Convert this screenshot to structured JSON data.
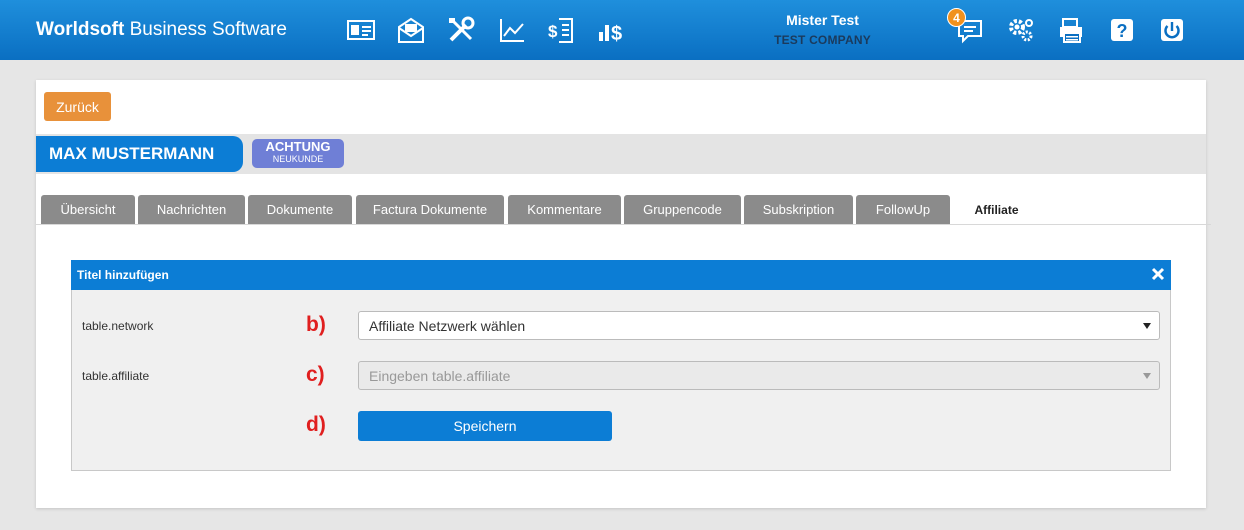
{
  "app": {
    "brand_bold": "Worldsoft",
    "brand_rest": " Business Software"
  },
  "nav_icons": [
    {
      "name": "contact-card-icon"
    },
    {
      "name": "mail-icon"
    },
    {
      "name": "tools-icon"
    },
    {
      "name": "chart-line-icon"
    },
    {
      "name": "invoice-dollar-icon"
    },
    {
      "name": "bar-dollar-icon"
    }
  ],
  "user": {
    "name": "Mister Test",
    "company": "TEST COMPANY"
  },
  "right_icons": {
    "messages_count": "4"
  },
  "back_button": "Zurück",
  "customer": {
    "name": "MAX MUSTERMANN",
    "alert_title": "ACHTUNG",
    "alert_sub": "NEUKUNDE"
  },
  "tabs": [
    "Übersicht",
    "Nachrichten",
    "Dokumente",
    "Factura Dokumente",
    "Kommentare",
    "Gruppencode",
    "Subskription",
    "FollowUp",
    "Affiliate"
  ],
  "active_tab": "Affiliate",
  "panel": {
    "title": "Titel hinzufügen",
    "rows": [
      {
        "label": "table.network",
        "marker": "b)",
        "value": "Affiliate Netzwerk wählen"
      },
      {
        "label": "table.affiliate",
        "marker": "c)",
        "placeholder": "Eingeben table.affiliate"
      }
    ],
    "save_marker": "d)",
    "save_label": "Speichern"
  },
  "colors": {
    "primary": "#0c7dd5",
    "back_button": "#e8913a",
    "alert_badge": "#6f7fd6",
    "marker": "#e01f1f",
    "tab_inactive": "#8b8b8b"
  }
}
